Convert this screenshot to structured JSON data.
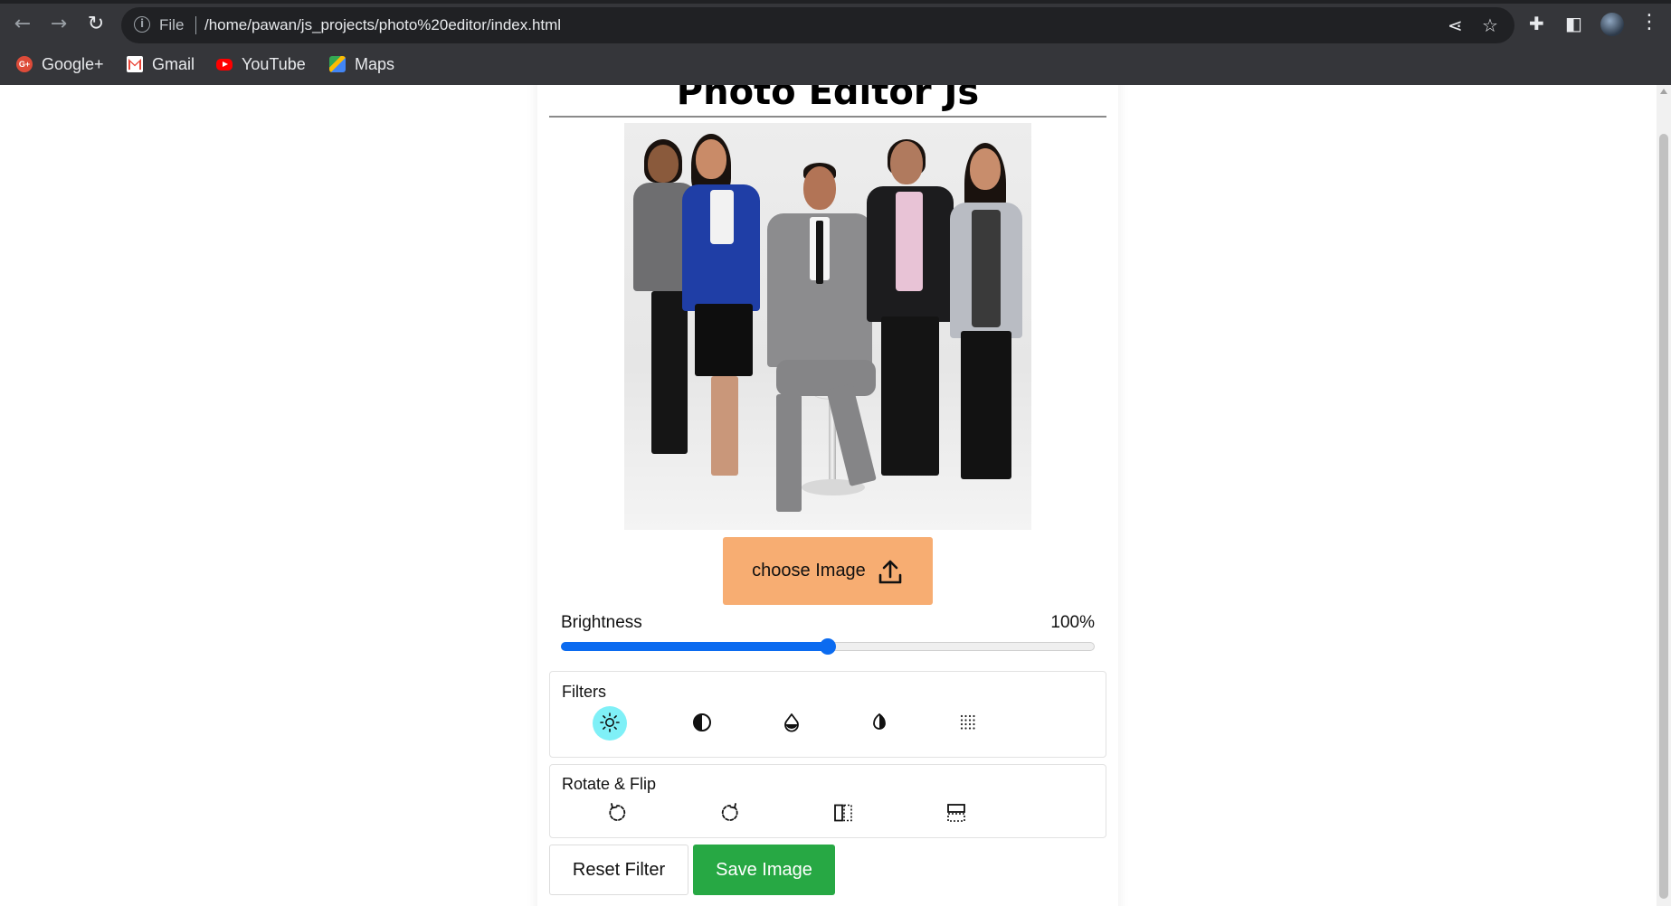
{
  "browser": {
    "nav": {
      "back_icon": "arrow-left-icon",
      "forward_icon": "arrow-right-icon",
      "reload_icon": "reload-icon"
    },
    "omnibox": {
      "scheme_label": "File",
      "url": "/home/pawan/js_projects/photo%20editor/index.html"
    },
    "bookmarks": [
      {
        "label": "Google+",
        "icon": "google-plus-icon"
      },
      {
        "label": "Gmail",
        "icon": "gmail-icon"
      },
      {
        "label": "YouTube",
        "icon": "youtube-icon"
      },
      {
        "label": "Maps",
        "icon": "maps-icon"
      }
    ]
  },
  "app": {
    "title": "Photo Editor Js",
    "choose_button": {
      "label": "choose Image",
      "icon": "upload-icon"
    },
    "brightness": {
      "label": "Brightness",
      "value_text": "100%",
      "slider_fraction": 0.5
    },
    "filters": {
      "title": "Filters",
      "options": [
        {
          "name": "brightness",
          "icon": "sun-icon",
          "active": true
        },
        {
          "name": "saturation",
          "icon": "half-circle-icon",
          "active": false
        },
        {
          "name": "inversion",
          "icon": "drop-icon",
          "active": false
        },
        {
          "name": "grayscale",
          "icon": "contrast-icon",
          "active": false
        },
        {
          "name": "blur",
          "icon": "dots-grid-icon",
          "active": false
        }
      ]
    },
    "rotate_flip": {
      "title": "Rotate & Flip",
      "options": [
        {
          "name": "rotate-left",
          "icon": "rotate-left-icon"
        },
        {
          "name": "rotate-right",
          "icon": "rotate-right-icon"
        },
        {
          "name": "flip-horizontal",
          "icon": "flip-horizontal-icon"
        },
        {
          "name": "flip-vertical",
          "icon": "flip-vertical-icon"
        }
      ]
    },
    "reset_button": {
      "label": "Reset Filter"
    },
    "save_button": {
      "label": "Save Image"
    }
  },
  "colors": {
    "choose_button": "#f7ad72",
    "slider_accent": "#0b6bf0",
    "active_filter": "#7ff0f7",
    "save_button": "#27a844"
  }
}
